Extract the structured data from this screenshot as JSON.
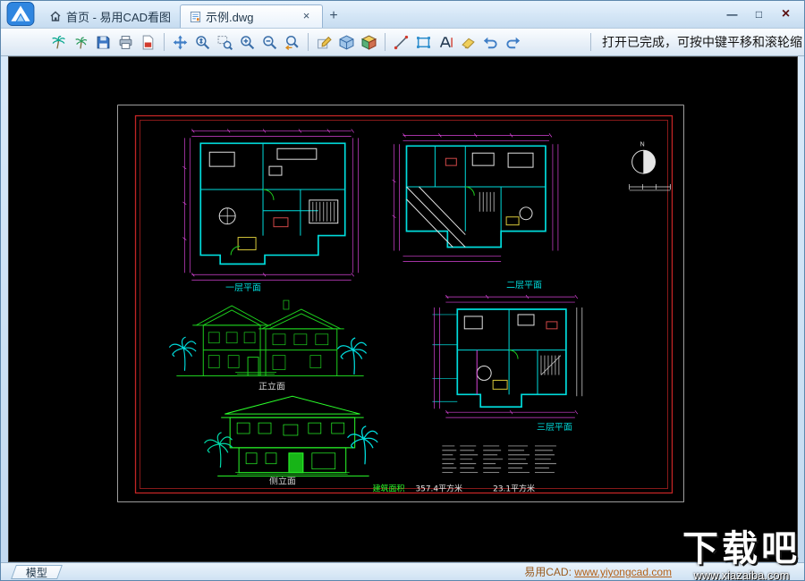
{
  "window": {
    "controls": {
      "minimize": "—",
      "maximize": "□",
      "close": "×"
    }
  },
  "tabs": {
    "home": {
      "label": "首页 - 易用CAD看图"
    },
    "document": {
      "label": "示例.dwg",
      "close_label": "×"
    },
    "new_tab_label": "+"
  },
  "toolbar": {
    "status_text": "打开已完成，可按中键平移和滚轮缩",
    "icons": [
      "palm-tree",
      "palm-tree-small",
      "save",
      "print",
      "pdf-export",
      "pan",
      "zoom-realtime",
      "zoom-window",
      "zoom-in",
      "zoom-out",
      "zoom-previous",
      "annotate",
      "cube-3d",
      "cube-3d-color",
      "measure-length",
      "measure-area",
      "text-annotation",
      "eraser",
      "undo",
      "redo"
    ]
  },
  "drawing": {
    "labels": {
      "plan_top_left": "一层平面",
      "plan_top_right": "二层平面",
      "plan_bottom_right": "三层平面",
      "elevation_front": "正立面",
      "elevation_side": "侧立面",
      "north": "N"
    },
    "caption": {
      "label": "建筑面积",
      "area1": "357.4平方米",
      "area2": "23.1平方米"
    }
  },
  "statusbar": {
    "model_tab": "模型",
    "promo_label": "易用CAD:",
    "promo_url": "www.yiyongcad.com"
  },
  "watermark": {
    "title": "下载吧",
    "url": "www.xiazaiba.com"
  }
}
